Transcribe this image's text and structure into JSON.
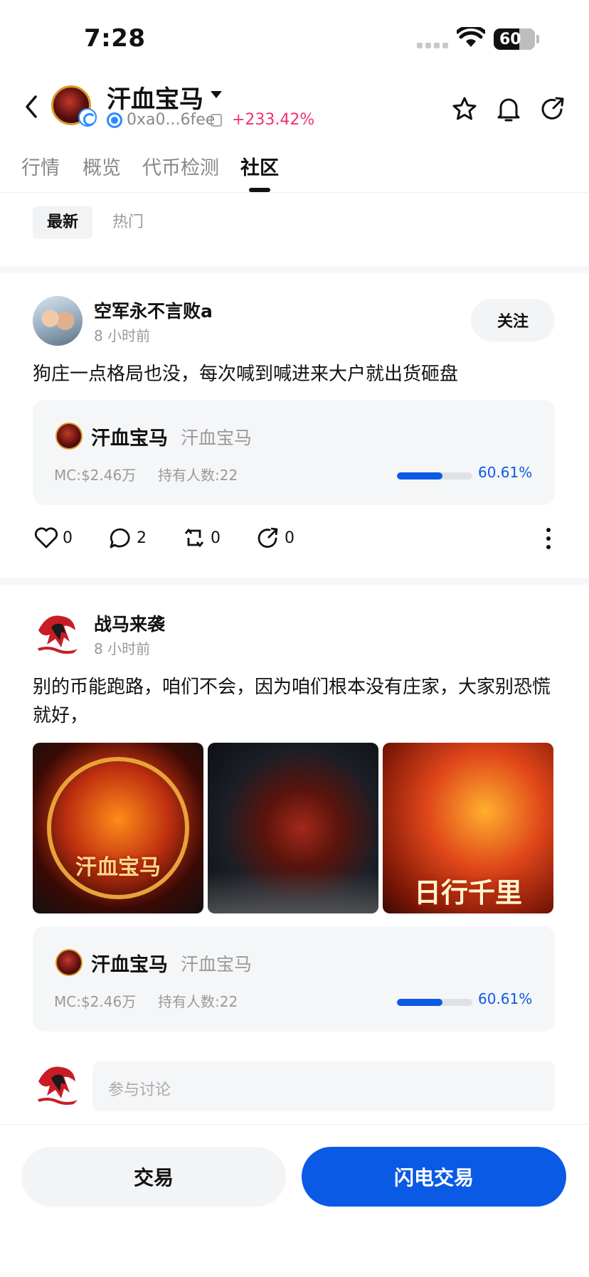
{
  "status_bar": {
    "time": "7:28",
    "battery": "60"
  },
  "header": {
    "token_name": "汗血宝马",
    "address": "0xa0...6fee",
    "change": "+233.42%"
  },
  "tabs": [
    {
      "label": "行情"
    },
    {
      "label": "概览"
    },
    {
      "label": "代币检测"
    },
    {
      "label": "社区",
      "active": true
    }
  ],
  "filters": [
    {
      "label": "最新",
      "active": true
    },
    {
      "label": "热门"
    }
  ],
  "posts": [
    {
      "user": "空军永不言败a",
      "time": "8 小时前",
      "follow_label": "关注",
      "text": "狗庄一点格局也没，每次喊到喊进来大户就出货砸盘",
      "token_card": {
        "name": "汗血宝马",
        "sub": "汗血宝马",
        "mc": "MC:$2.46万",
        "holders": "持有人数:22",
        "progress_pct": 60.61,
        "progress_label": "60.61%"
      },
      "likes": "0",
      "comments": "2",
      "reposts": "0",
      "shares": "0"
    },
    {
      "user": "战马来袭",
      "time": "8 小时前",
      "text": "别的币能跑路，咱们不会，因为咱们根本没有庄家，大家别恐慌就好，",
      "images": [
        {
          "caption": "汗血宝马"
        },
        {
          "caption": ""
        },
        {
          "caption": "日行千里"
        }
      ],
      "token_card": {
        "name": "汗血宝马",
        "sub": "汗血宝马",
        "mc": "MC:$2.46万",
        "holders": "持有人数:22",
        "progress_pct": 60.61,
        "progress_label": "60.61%"
      }
    }
  ],
  "comment_input": {
    "placeholder": "参与讨论"
  },
  "bottom_bar": {
    "trade_label": "交易",
    "flash_trade_label": "闪电交易"
  },
  "colors": {
    "accent": "#0b5ae6",
    "positive": "#f0336b"
  }
}
